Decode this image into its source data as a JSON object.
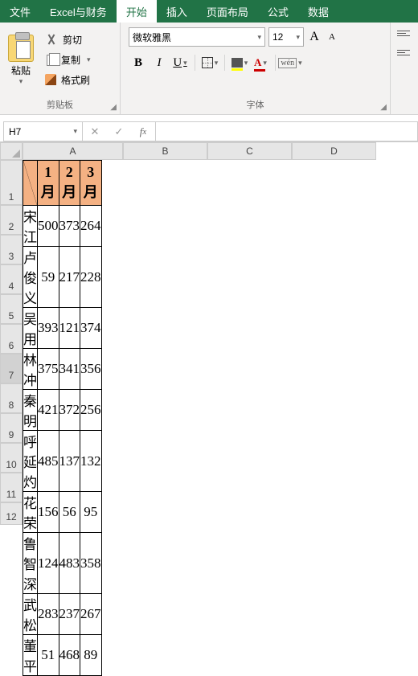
{
  "tabs": [
    "文件",
    "Excel与财务",
    "开始",
    "插入",
    "页面布局",
    "公式",
    "数据"
  ],
  "active_tab": 2,
  "clipboard": {
    "paste": "粘贴",
    "cut": "剪切",
    "copy": "复制",
    "format_painter": "格式刷",
    "group": "剪贴板"
  },
  "font": {
    "name": "微软雅黑",
    "size": "12",
    "group": "字体",
    "wen": "wén"
  },
  "namebox": "H7",
  "formula": "",
  "columns": [
    "A",
    "B",
    "C",
    "D"
  ],
  "row_numbers": [
    "1",
    "2",
    "3",
    "4",
    "5",
    "6",
    "7",
    "8",
    "9",
    "10",
    "11",
    "12"
  ],
  "selected_row": 7,
  "col_widths": {
    "A": 125,
    "B": 105,
    "C": 105,
    "D": 105
  },
  "header_row": [
    "",
    "1月",
    "2月",
    "3月"
  ],
  "chart_data": {
    "type": "table",
    "columns": [
      "",
      "1月",
      "2月",
      "3月"
    ],
    "rows": [
      [
        "宋江",
        500,
        373,
        264
      ],
      [
        "卢俊义",
        59,
        217,
        228
      ],
      [
        "吴用",
        393,
        121,
        374
      ],
      [
        "林冲",
        375,
        341,
        356
      ],
      [
        "秦明",
        421,
        372,
        256
      ],
      [
        "呼延灼",
        485,
        137,
        132
      ],
      [
        "花荣",
        156,
        56,
        95
      ],
      [
        "鲁智深",
        124,
        483,
        358
      ],
      [
        "武松",
        283,
        237,
        267
      ],
      [
        "董平",
        51,
        468,
        89
      ]
    ]
  }
}
